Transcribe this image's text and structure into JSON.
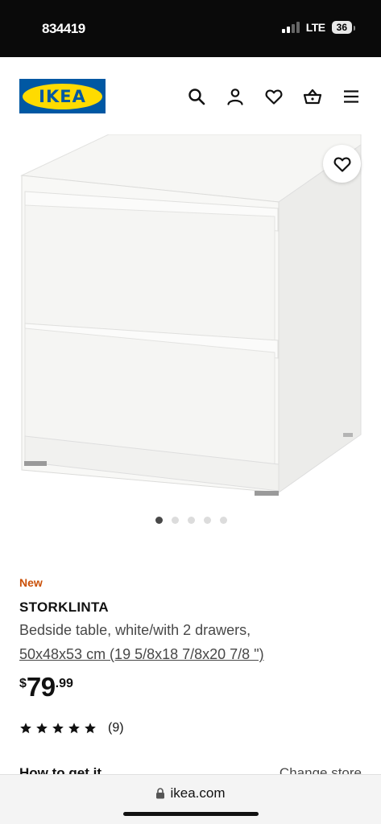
{
  "status_bar": {
    "time": "834419",
    "network": "LTE",
    "battery": "36"
  },
  "header": {
    "logo_text": "IKEA",
    "icons": [
      "search-icon",
      "account-icon",
      "heart-icon",
      "basket-icon",
      "menu-icon"
    ]
  },
  "product": {
    "badge": "New",
    "name": "STORKLINTA",
    "description": "Bedside table, white/with 2 drawers,",
    "size": "50x48x53 cm (19 5/8x18 7/8x20 7/8 \")",
    "price": {
      "currency": "$",
      "whole": "79",
      "decimal": ".99"
    },
    "rating": {
      "stars": 5,
      "count": "(9)"
    },
    "image_dots": {
      "total": 5,
      "active_index": 0
    }
  },
  "fulfillment": {
    "label": "How to get it",
    "change_store": "Change store"
  },
  "browser": {
    "url": "ikea.com"
  },
  "colors": {
    "ikea_blue": "#0058a3",
    "ikea_yellow": "#ffdb00",
    "new_badge": "#ca5008",
    "text_primary": "#111111",
    "text_secondary": "#484848"
  }
}
